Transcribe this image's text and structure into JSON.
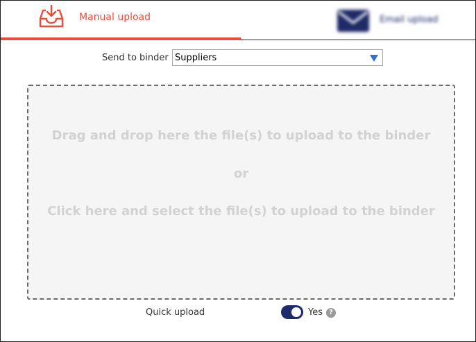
{
  "tabs": {
    "manual": {
      "label": "Manual upload",
      "icon": "inbox-download-icon",
      "color": "#e84c3d",
      "active": true
    },
    "email": {
      "label": "Email upload",
      "icon": "envelope-icon",
      "color": "#1f2a66",
      "active": false
    }
  },
  "binder": {
    "label": "Send to binder",
    "selected": "Suppliers"
  },
  "dropzone": {
    "line1": "Drag and drop here the file(s) to upload to the binder",
    "or": "or",
    "line2": "Click here and select the file(s) to upload to the binder"
  },
  "quick_upload": {
    "label": "Quick upload",
    "value_label": "Yes",
    "enabled": true,
    "help_glyph": "?"
  }
}
